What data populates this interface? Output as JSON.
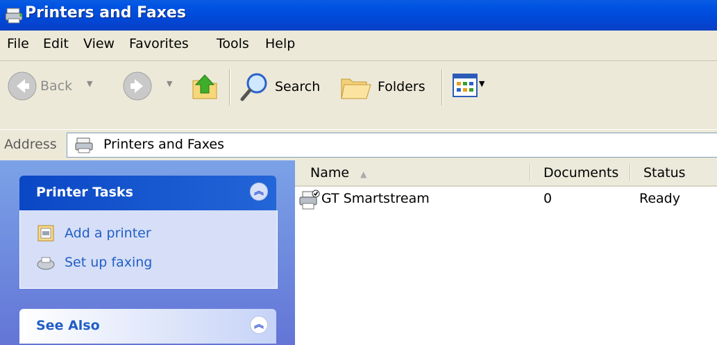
{
  "window": {
    "title": "Printers and Faxes"
  },
  "menu": [
    "File",
    "Edit",
    "View",
    "Favorites",
    "Tools",
    "Help"
  ],
  "toolbar": {
    "back_label": "Back",
    "search_label": "Search",
    "folders_label": "Folders"
  },
  "address": {
    "label": "Address",
    "value": "Printers and Faxes"
  },
  "tasks": {
    "printer_tasks_title": "Printer Tasks",
    "items": [
      "Add a printer",
      "Set up faxing"
    ],
    "see_also_title": "See Also"
  },
  "list": {
    "columns": [
      "Name",
      "Documents",
      "Status"
    ],
    "rows": [
      {
        "name": "GT Smartstream",
        "documents": "0",
        "status": "Ready"
      }
    ]
  },
  "colors": {
    "titlebar": "#0054e3",
    "taskpane": "#7ba2e7",
    "link": "#215dc6"
  }
}
